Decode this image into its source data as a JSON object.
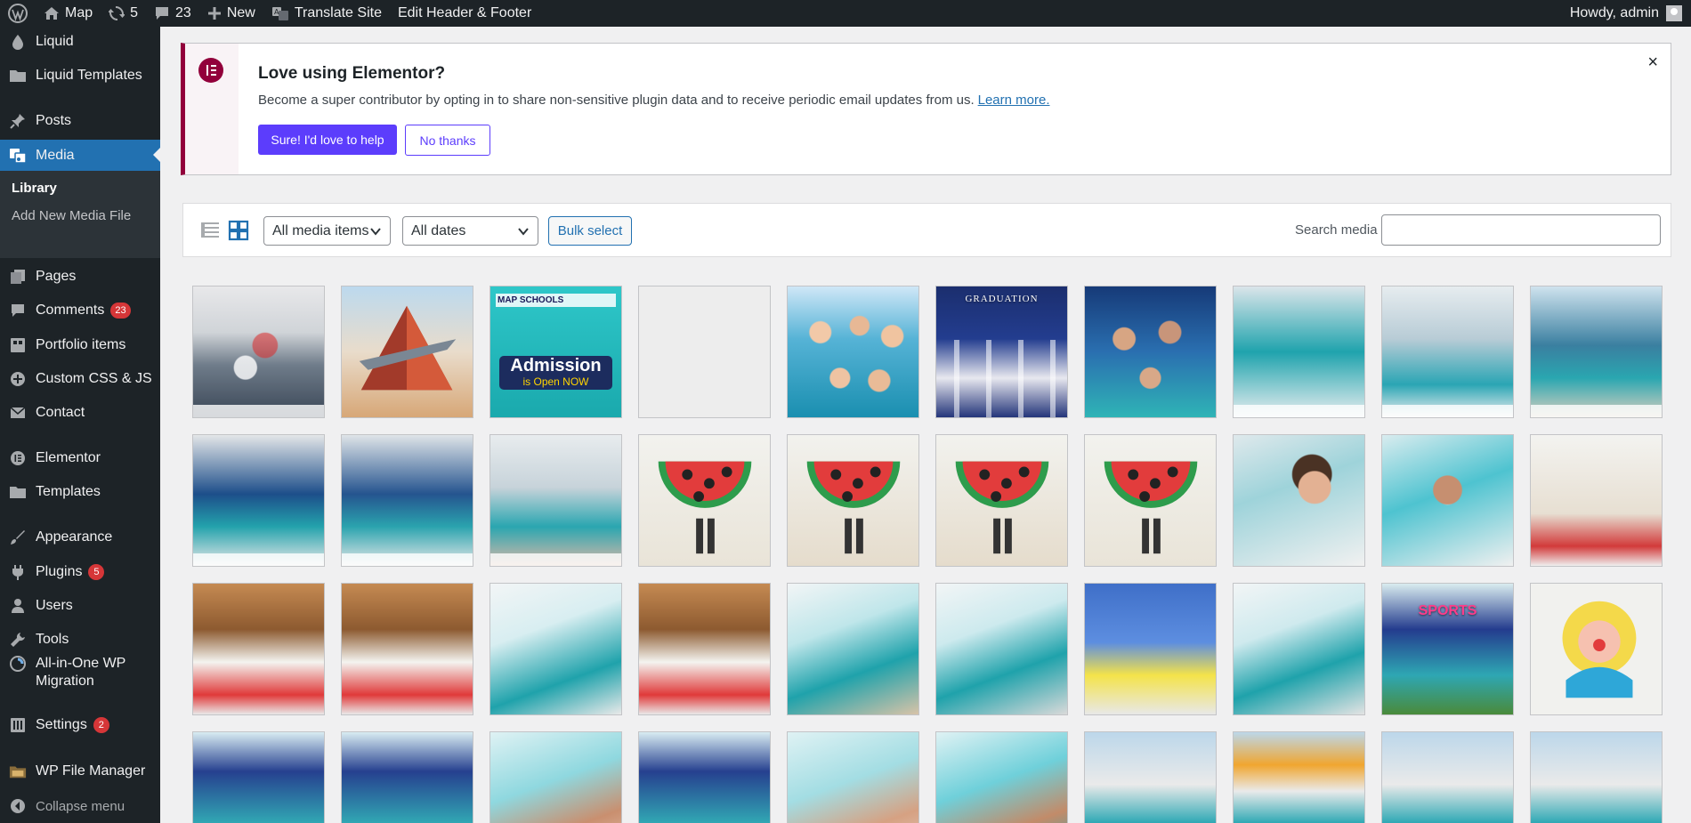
{
  "adminbar": {
    "site_name": "Map",
    "updates_count": "5",
    "comments_count": "23",
    "new_label": "New",
    "translate_label": "Translate Site",
    "edit_hf_label": "Edit Header & Footer",
    "howdy": "Howdy, admin"
  },
  "sidebar": {
    "items": [
      {
        "label": "Liquid",
        "icon": "drop-icon"
      },
      {
        "label": "Liquid Templates",
        "icon": "folder-icon"
      },
      {
        "label": "Posts",
        "icon": "pin-icon"
      },
      {
        "label": "Media",
        "icon": "media-icon"
      },
      {
        "label": "Pages",
        "icon": "pages-icon"
      },
      {
        "label": "Comments",
        "icon": "comment-icon",
        "badge": "23"
      },
      {
        "label": "Portfolio items",
        "icon": "portfolio-icon"
      },
      {
        "label": "Custom CSS & JS",
        "icon": "plus-circle-icon"
      },
      {
        "label": "Contact",
        "icon": "mail-icon"
      },
      {
        "label": "Elementor",
        "icon": "elementor-icon"
      },
      {
        "label": "Templates",
        "icon": "folder-icon"
      },
      {
        "label": "Appearance",
        "icon": "brush-icon"
      },
      {
        "label": "Plugins",
        "icon": "plugin-icon",
        "badge": "5"
      },
      {
        "label": "Users",
        "icon": "user-icon"
      },
      {
        "label": "Tools",
        "icon": "wrench-icon"
      },
      {
        "label": "All-in-One WP Migration",
        "icon": "migration-icon"
      },
      {
        "label": "Settings",
        "icon": "settings-icon",
        "badge": "2"
      },
      {
        "label": "WP File Manager",
        "icon": "file-manager-icon"
      },
      {
        "label": "Collapse menu",
        "icon": "collapse-icon"
      }
    ],
    "submenu": {
      "library": "Library",
      "add_new": "Add New Media File"
    }
  },
  "notice": {
    "title": "Love using Elementor?",
    "text": "Become a super contributor by opting in to share non-sensitive plugin data and to receive periodic email updates from us.",
    "link": "Learn more.",
    "primary_button": "Sure! I'd love to help",
    "secondary_button": "No thanks",
    "close": "×"
  },
  "toolbar": {
    "filter_type": "All media items",
    "filter_date": "All dates",
    "bulk_select": "Bulk select",
    "search_label": "Search media",
    "search_value": ""
  },
  "grid": {
    "admission_brand": "MAP SCHOOLS",
    "admission_title": "Admission",
    "admission_sub": "is Open NOW",
    "graduation_label": "GRADUATION",
    "sports_label": "SPORTS"
  },
  "colors": {
    "adminbar_bg": "#1d2327",
    "accent": "#2271b1",
    "elementor": "#92003b",
    "elementor_button": "#5c3dfc",
    "badge": "#d63638"
  }
}
